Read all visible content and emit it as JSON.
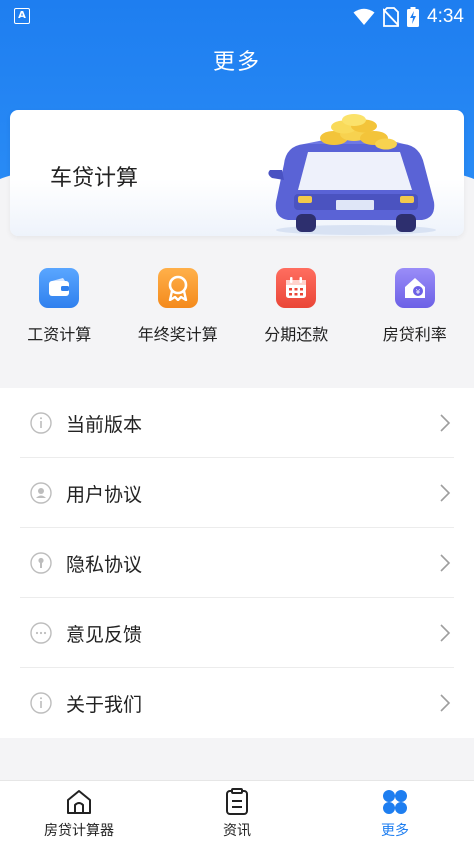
{
  "status": {
    "app_badge": "A",
    "time": "4:34"
  },
  "header": {
    "title": "更多"
  },
  "banner": {
    "title": "车贷计算"
  },
  "quick": [
    {
      "label": "工资计算",
      "icon": "wallet-icon",
      "color": "#3b8ff5"
    },
    {
      "label": "年终奖计算",
      "icon": "award-icon",
      "color": "#f59a2e"
    },
    {
      "label": "分期还款",
      "icon": "calendar-icon",
      "color": "#f0584c"
    },
    {
      "label": "房贷利率",
      "icon": "house-rate-icon",
      "color": "#7f72f0"
    }
  ],
  "menu": [
    {
      "label": "当前版本",
      "icon": "info-icon"
    },
    {
      "label": "用户协议",
      "icon": "user-icon"
    },
    {
      "label": "隐私协议",
      "icon": "lock-icon"
    },
    {
      "label": "意见反馈",
      "icon": "chat-icon"
    },
    {
      "label": "关于我们",
      "icon": "info-icon"
    }
  ],
  "tabs": [
    {
      "label": "房贷计算器",
      "icon": "house-icon",
      "active": false
    },
    {
      "label": "资讯",
      "icon": "news-icon",
      "active": false
    },
    {
      "label": "更多",
      "icon": "grid-icon",
      "active": true
    }
  ],
  "colors": {
    "primary": "#1e7ef0",
    "background": "#f4f4f6"
  }
}
